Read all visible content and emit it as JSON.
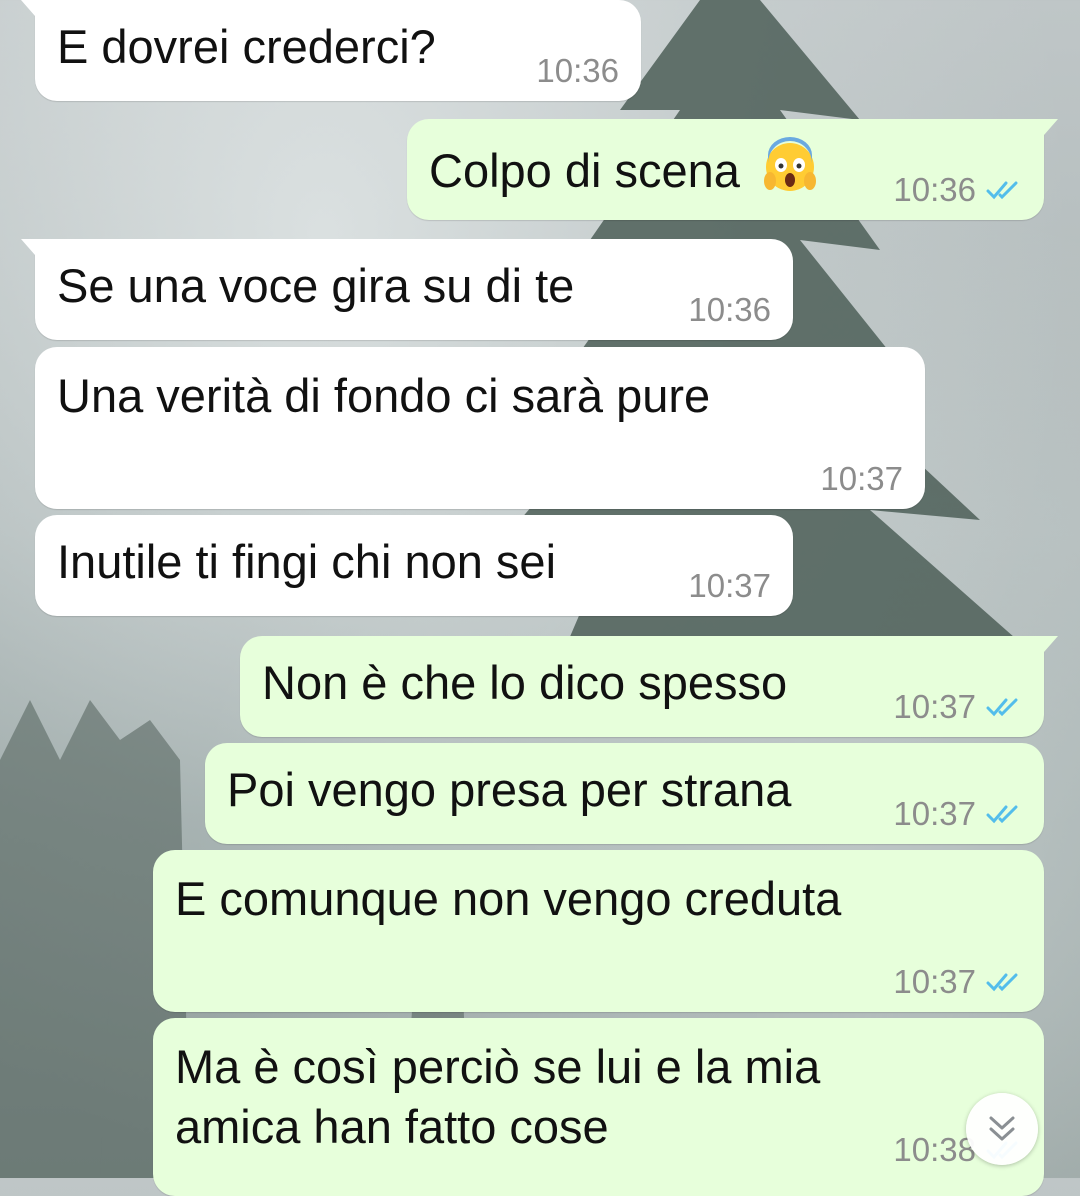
{
  "chat": {
    "messages": [
      {
        "direction": "in",
        "text": "E dovrei crederci?",
        "time": "10:36"
      },
      {
        "direction": "out",
        "text": "Colpo di scena",
        "emoji": "face-screaming-in-fear",
        "time": "10:36",
        "status": "read"
      },
      {
        "direction": "in",
        "text": "Se una voce gira su di te",
        "time": "10:36"
      },
      {
        "direction": "in",
        "text": "Una verità di fondo ci sarà pure",
        "time": "10:37"
      },
      {
        "direction": "in",
        "text": "Inutile ti fingi chi non sei",
        "time": "10:37"
      },
      {
        "direction": "out",
        "text": "Non è che lo dico spesso",
        "time": "10:37",
        "status": "read"
      },
      {
        "direction": "out",
        "text": "Poi vengo presa per strana",
        "time": "10:37",
        "status": "read"
      },
      {
        "direction": "out",
        "text": "E comunque non vengo creduta",
        "time": "10:37",
        "status": "read"
      },
      {
        "direction": "out",
        "text_line1": "Ma è così perciò se lui e la mia",
        "text_line2": "amica han fatto cose",
        "time": "10:38",
        "status": "read"
      }
    ]
  },
  "colors": {
    "incoming_bubble": "#ffffff",
    "outgoing_bubble": "#e7ffdb",
    "read_ticks": "#53bdeb",
    "timestamp": "#8c8c8c"
  },
  "icons": {
    "read_receipt": "double-check-icon",
    "scroll_down": "double-chevron-down-icon"
  }
}
